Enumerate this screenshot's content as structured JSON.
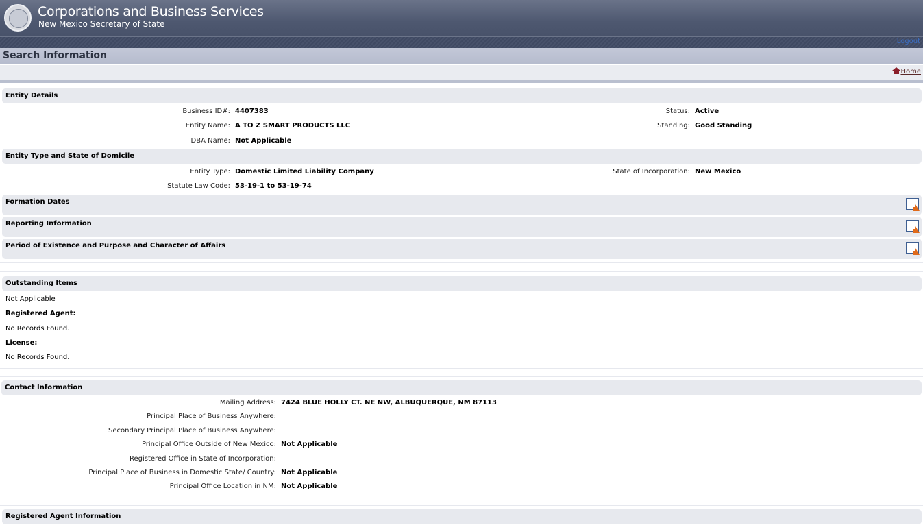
{
  "header": {
    "title": "Corporations and Business Services",
    "subtitle": "New Mexico Secretary of State",
    "top_link": "Logout"
  },
  "search_title": "Search Information",
  "home_link": "Home",
  "entity_details": {
    "heading": "Entity Details",
    "business_id_label": "Business ID#:",
    "business_id": "4407383",
    "entity_name_label": "Entity Name:",
    "entity_name": "A TO Z SMART PRODUCTS LLC",
    "dba_label": "DBA Name:",
    "dba": "Not Applicable",
    "status_label": "Status:",
    "status": "Active",
    "standing_label": "Standing:",
    "standing": "Good Standing"
  },
  "entity_type": {
    "heading": "Entity Type and State of Domicile",
    "type_label": "Entity Type:",
    "type": "Domestic Limited Liability Company",
    "statute_label": "Statute Law Code:",
    "statute": "53-19-1 to 53-19-74",
    "incorporation_label": "State of Incorporation:",
    "incorporation": "New Mexico"
  },
  "collapsed_sections": [
    "Formation Dates",
    "Reporting Information",
    "Period of Existence and Purpose and Character of Affairs"
  ],
  "outstanding": {
    "heading": "Outstanding Items",
    "value": "Not Applicable",
    "agent_label": "Registered Agent:",
    "agent_value": "No Records Found.",
    "license_label": "License:",
    "license_value": "No Records Found."
  },
  "contact": {
    "heading": "Contact Information",
    "rows": [
      {
        "label": "Mailing Address:",
        "value": "7424 BLUE HOLLY CT. NE NW, ALBUQUERQUE, NM 87113"
      },
      {
        "label": "Principal Place of Business Anywhere:",
        "value": ""
      },
      {
        "label": "Secondary Principal Place of Business Anywhere:",
        "value": ""
      },
      {
        "label": "Principal Office Outside of New Mexico:",
        "value": "Not Applicable"
      },
      {
        "label": "Registered Office in State of Incorporation:",
        "value": ""
      },
      {
        "label": "Principal Place of Business in Domestic State/ Country:",
        "value": "Not Applicable"
      },
      {
        "label": "Principal Office Location in NM:",
        "value": "Not Applicable"
      }
    ]
  },
  "registered_agent": {
    "heading": "Registered Agent Information"
  }
}
